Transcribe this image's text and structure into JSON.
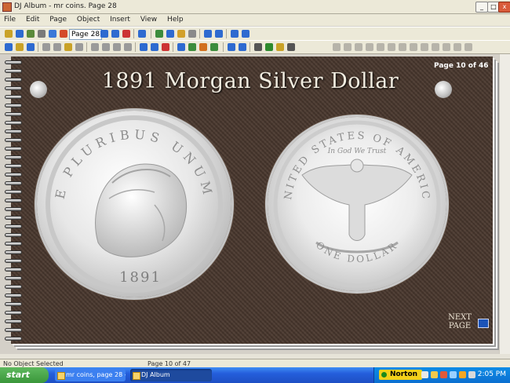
{
  "window": {
    "title": "DJ Album - mr coins. Page 28",
    "minimize_symbol": "_",
    "maximize_symbol": "□",
    "close_symbol": "x"
  },
  "menu": [
    "File",
    "Edit",
    "Page",
    "Object",
    "Insert",
    "View",
    "Help"
  ],
  "toolbar": {
    "page_selector": "Page 28"
  },
  "album_page": {
    "page_indicator": "Page 10 of 46",
    "title": "1891 Morgan  Silver Dollar",
    "next_page": [
      "NEXT",
      "PAGE"
    ],
    "obverse": {
      "motto": "E PLURIBUS UNUM",
      "year": "1891"
    },
    "reverse": {
      "legend": "UNITED STATES OF AMERICA",
      "motto": "In God We Trust",
      "denomination": "ONE DOLLAR"
    }
  },
  "statusbar": {
    "left": "No Object Selected",
    "middle": "Page 10 of 47"
  },
  "taskbar": {
    "start_label": "start",
    "tasks": [
      "mr coins, page 28 - C...",
      "DJ Album"
    ],
    "norton_label": "Norton",
    "clock": "2:05 PM"
  },
  "colors": {
    "page_background": "#4d3b31",
    "heading": "#f1ece0",
    "taskbar": "#245edb",
    "start_button": "#3a963a"
  }
}
